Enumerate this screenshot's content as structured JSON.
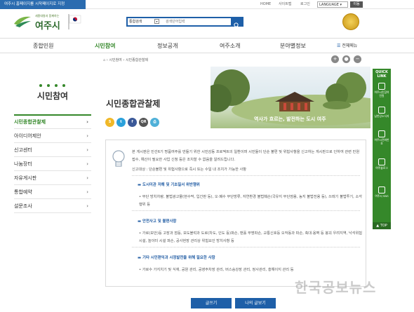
{
  "topbar": {
    "notice": "여주시 홈페이지를 시작페이지로 지정",
    "links": [
      "HOME",
      "사이트맵",
      "로그인"
    ],
    "language_label": "LANGUAGE",
    "language_go": "이동"
  },
  "header": {
    "logo_subtitle": "세종대왕과 함께하는",
    "logo_text": "여주시"
  },
  "search": {
    "scope": "통합검색",
    "placeholder": "검색단어입력"
  },
  "gnb": {
    "items": [
      "종합민원",
      "시민참여",
      "정보공개",
      "여주소개",
      "분야별정보"
    ],
    "active_index": 1,
    "all_menu": "전체메뉴"
  },
  "breadcrumb": {
    "home": "",
    "path": "› 시민참여 › 시민종합관찰제"
  },
  "lnb": {
    "title": "시민참여",
    "items": [
      "시민종합관찰제",
      "아이디어제안",
      "신고센터",
      "나눔장터",
      "자유게시판",
      "통합예약",
      "설문조사"
    ],
    "active_index": 0
  },
  "page": {
    "title": "시민종합관찰제",
    "banner_tag": "역사가 흐르는, 발전하는 도시 여주"
  },
  "content": {
    "intro": "본 게시판은 민선6기 명품여주를 만들기 위한 시민감동 프로젝트의 일환이며 시민들이 단순 불편 및 위험사항을 신고하는 게시판으로 인하여 관련 민원접수, 예산이 필요한 사업 신청 등은 조치할 수 없음을 알려드립니다.",
    "target": "신고대상 : 단순불편 및 위험사항으로 즉시 또는 수일 내 조치가 가능한 사항",
    "sections": [
      {
        "heading": "도시미관 저해 및 기초질서 위반행위",
        "body": "무단 방치차량, 불법광고물(현수막, 입간판 등), 오·폐수 무단방류, 자연환경 불법훼손(국유지 무단점용, 농지 불법전용 등), 쓰레기 불법투기, 소각행위 등"
      },
      {
        "heading": "안전사고 및 불편사항",
        "body": "가로(보안)등 고장과 점등, 보도블럭과 도로(차도, 인도 등)파손, 맨홀 무명파손, 교통신호등 오작동과 파손, 축대·옹벽 등 붕괴 우려지역, 낙석위험시설, 놀이터 시설 파손, 공사현장 관리상 위험요인 방치사항 등"
      },
      {
        "heading": "기타 시민편익과 시정발전을 위해 필요한 사항",
        "body": "가로수 가지치기 및 식재, 공원 관리, 공영주차장 관리, 버스승강장 관리, 정사관리, 홍해이지 관리 등"
      }
    ]
  },
  "buttons": {
    "write": "글쓰기",
    "my_posts": "나의 글보기"
  },
  "quick_link": {
    "title": "QUICK LINK",
    "items": [
      "여주시민참여민원",
      "남한강소식지",
      "여주시전화번호",
      "여주블로그",
      "여주시 SNS"
    ],
    "top": "TOP"
  },
  "watermark": "한국공보뉴스",
  "colors": {
    "brand_green": "#35882a",
    "brand_blue": "#1e5fa8"
  }
}
